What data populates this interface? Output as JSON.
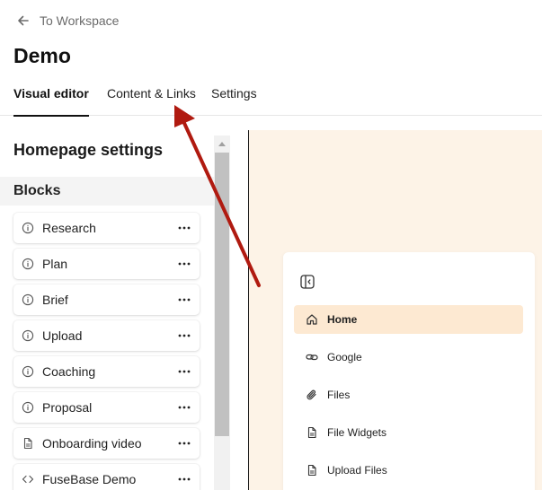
{
  "header": {
    "back_label": "To Workspace",
    "title": "Demo"
  },
  "tabs": [
    {
      "label": "Visual editor",
      "active": true
    },
    {
      "label": "Content & Links",
      "active": false
    },
    {
      "label": "Settings",
      "active": false
    }
  ],
  "left_panel": {
    "heading": "Homepage settings",
    "section_label": "Blocks",
    "blocks": [
      {
        "label": "Research",
        "icon": "info-icon"
      },
      {
        "label": "Plan",
        "icon": "info-icon"
      },
      {
        "label": "Brief",
        "icon": "info-icon"
      },
      {
        "label": "Upload",
        "icon": "info-icon"
      },
      {
        "label": "Coaching",
        "icon": "info-icon"
      },
      {
        "label": "Proposal",
        "icon": "info-icon"
      },
      {
        "label": "Onboarding video",
        "icon": "file-icon"
      },
      {
        "label": "FuseBase Demo",
        "icon": "code-icon"
      }
    ]
  },
  "preview": {
    "nav_items": [
      {
        "label": "Home",
        "icon": "home-icon",
        "active": true
      },
      {
        "label": "Google",
        "icon": "link-icon",
        "active": false
      },
      {
        "label": "Files",
        "icon": "paperclip-icon",
        "active": false
      },
      {
        "label": "File Widgets",
        "icon": "file-icon",
        "active": false
      },
      {
        "label": "Upload Files",
        "icon": "file-icon",
        "active": false
      }
    ]
  },
  "colors": {
    "preview_background": "#fdf3e7",
    "active_nav_background": "#fde9d2",
    "annotation_arrow": "#b01a10"
  }
}
